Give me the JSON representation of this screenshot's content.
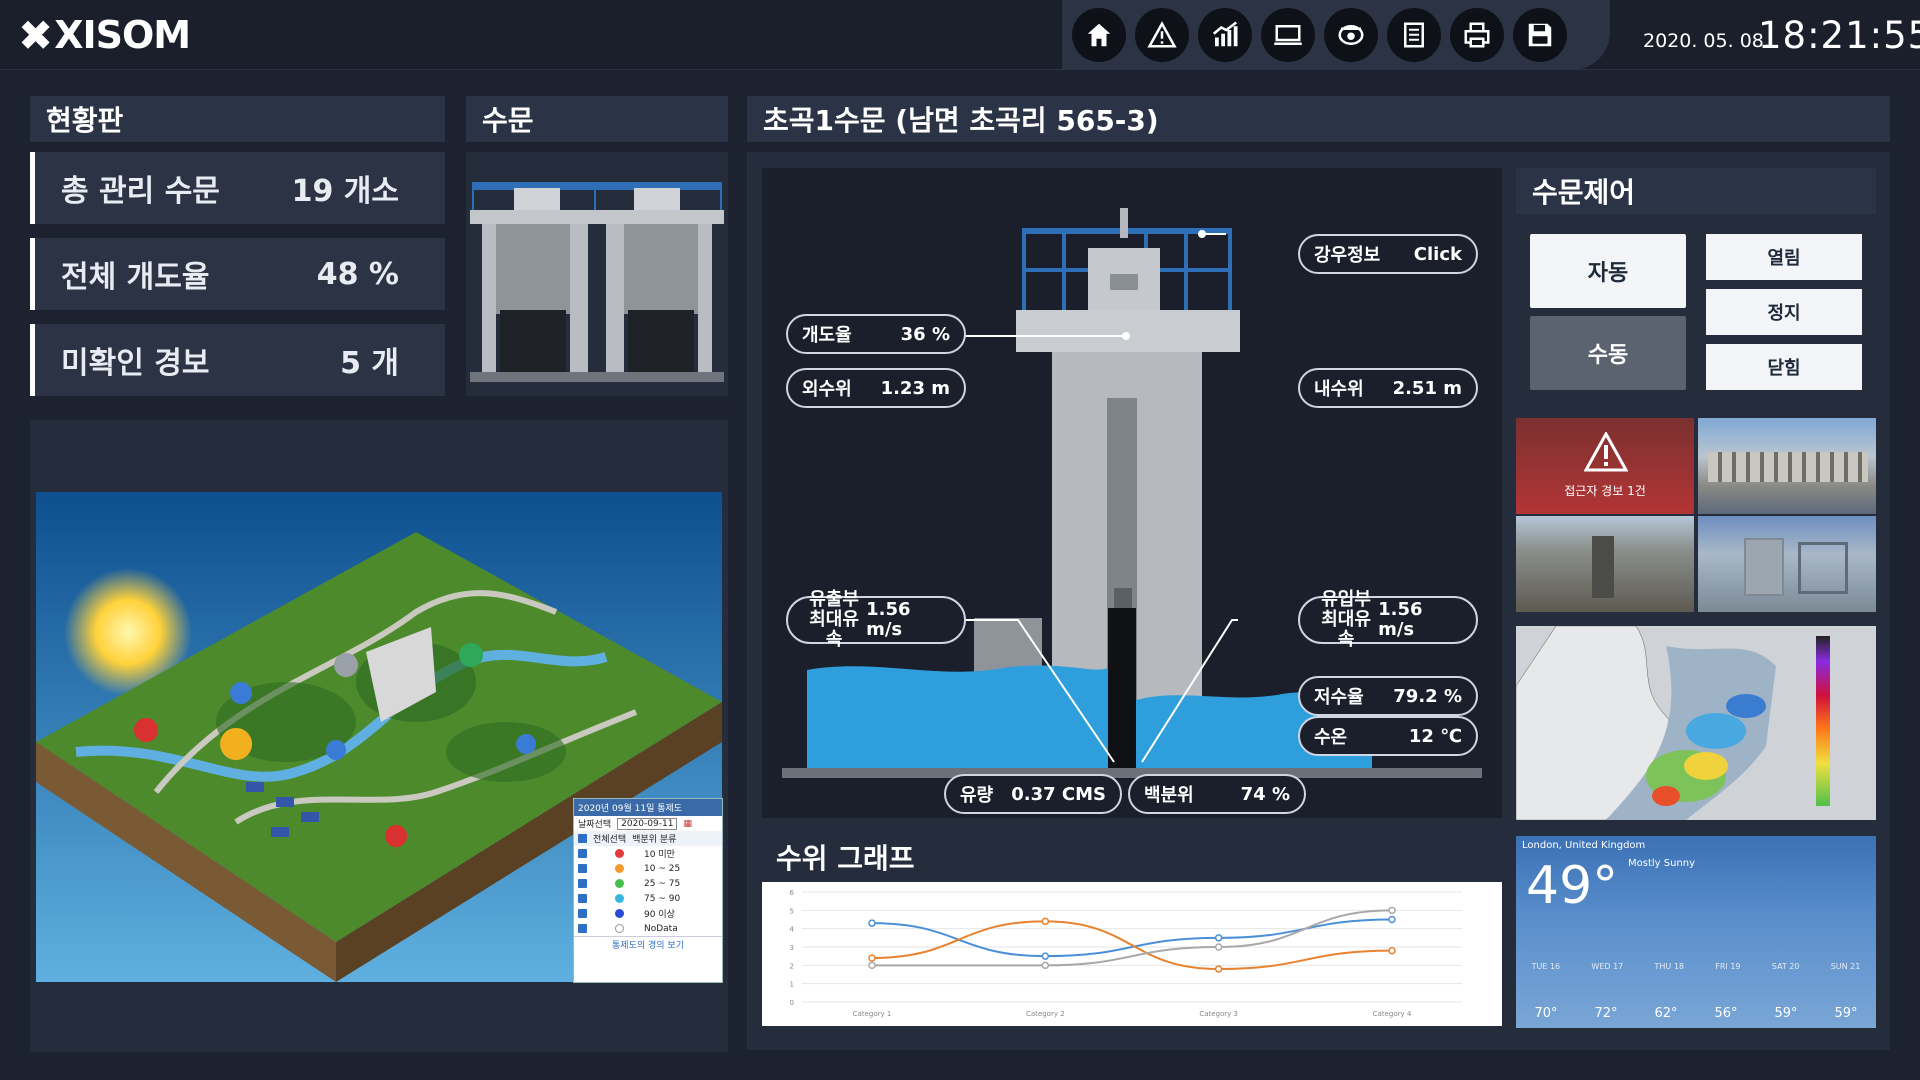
{
  "app": {
    "logo": "XISOM",
    "date": "2020. 05. 08.",
    "time": "18:21:55",
    "toolbar": [
      {
        "name": "home-icon"
      },
      {
        "name": "alarm-icon"
      },
      {
        "name": "chart-icon"
      },
      {
        "name": "monitor-icon"
      },
      {
        "name": "cctv-icon"
      },
      {
        "name": "report-icon"
      },
      {
        "name": "print-icon"
      },
      {
        "name": "save-icon"
      }
    ]
  },
  "status": {
    "title": "현황판",
    "rows": [
      {
        "label": "총 관리 수문",
        "value": "19 개소"
      },
      {
        "label": "전체 개도율",
        "value": "48 %"
      },
      {
        "label": "미확인 경보",
        "value": "5 개"
      }
    ]
  },
  "gate": {
    "title": "수문"
  },
  "detail": {
    "title": "초곡1수문 (남면 초곡리 565-3)",
    "rain": {
      "label": "강우정보",
      "action": "Click"
    },
    "opening": {
      "label": "개도율",
      "value": "36 %"
    },
    "outer_level": {
      "label": "외수위",
      "value": "1.23 m"
    },
    "inner_level": {
      "label": "내수위",
      "value": "2.51 m"
    },
    "out_velocity": {
      "label": "유출부\n최대유속",
      "value": "1.56 m/s"
    },
    "in_velocity": {
      "label": "유입부\n최대유속",
      "value": "1.56 m/s"
    },
    "storage": {
      "label": "저수율",
      "value": "79.2 %"
    },
    "water_temp": {
      "label": "수온",
      "value": "12 ℃"
    },
    "flow": {
      "label": "유량",
      "value": "0.37 CMS"
    },
    "percentile": {
      "label": "백분위",
      "value": "74 %"
    }
  },
  "graph": {
    "title": "수위 그래프"
  },
  "chart_data": {
    "type": "line",
    "categories": [
      "Category 1",
      "Category 2",
      "Category 3",
      "Category 4"
    ],
    "series": [
      {
        "values": [
          4.3,
          2.5,
          3.5,
          4.5
        ],
        "color": "#4a90d9"
      },
      {
        "values": [
          2.4,
          4.4,
          1.8,
          2.8
        ],
        "color": "#e8822e"
      },
      {
        "values": [
          2.0,
          2.0,
          3.0,
          5.0
        ],
        "color": "#a8a8a8"
      }
    ],
    "ylim": [
      0,
      6
    ],
    "grid": true
  },
  "legend": {
    "title": "2020년 09월 11일 통제도",
    "date_label": "날짜선택",
    "date_value": "2020-09-11",
    "col_a": "전체선택",
    "col_b": "백분위 분류",
    "rows": [
      {
        "range": "10 미만",
        "color": "#e23b3b"
      },
      {
        "range": "10 ~ 25",
        "color": "#f29a2e"
      },
      {
        "range": "25 ~ 75",
        "color": "#45c04a"
      },
      {
        "range": "75 ~ 90",
        "color": "#36b6e0"
      },
      {
        "range": "90 이상",
        "color": "#2a4bd8"
      },
      {
        "range": "NoData",
        "color": "#ffffff"
      }
    ],
    "footer": "통제도의 경의 보기"
  },
  "control": {
    "title": "수문제어",
    "auto": "자동",
    "manual": "수동",
    "open": "열림",
    "stop": "정지",
    "close": "닫힘"
  },
  "cctv": {
    "alarm_text": "접근자 경보 1건"
  },
  "weather": {
    "location": "London, United Kingdom",
    "temp": "49°",
    "condition": "Mostly Sunny",
    "days": [
      {
        "day": "TUE 16",
        "temp": "70°"
      },
      {
        "day": "WED 17",
        "temp": "72°"
      },
      {
        "day": "THU 18",
        "temp": "62°"
      },
      {
        "day": "FRI 19",
        "temp": "56°"
      },
      {
        "day": "SAT 20",
        "temp": "59°"
      },
      {
        "day": "SUN 21",
        "temp": "59°"
      }
    ]
  }
}
